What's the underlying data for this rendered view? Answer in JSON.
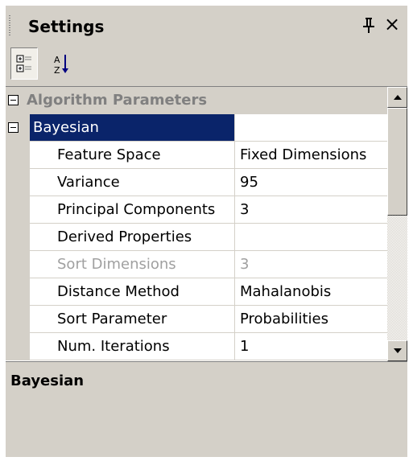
{
  "panel": {
    "title": "Settings",
    "pin_glyph": "↓",
    "close_glyph": "×"
  },
  "toolbar": {
    "categorized_icon": "categorized-view-icon",
    "alphabetical_icon": "alphabetical-sort-icon"
  },
  "grid": {
    "category": "Algorithm Parameters",
    "subcategory": "Bayesian",
    "rows": [
      {
        "name": "Feature Space",
        "value": "Fixed Dimensions"
      },
      {
        "name": "Variance",
        "value": "95"
      },
      {
        "name": "Principal Components",
        "value": "3"
      },
      {
        "name": "Derived Properties",
        "value": ""
      },
      {
        "name": "Sort Dimensions",
        "value": "3"
      },
      {
        "name": "Distance Method",
        "value": "Mahalanobis"
      },
      {
        "name": "Sort Parameter",
        "value": "Probabilities"
      },
      {
        "name": "Num. Iterations",
        "value": "1"
      }
    ]
  },
  "description": {
    "title": "Bayesian"
  },
  "colors": {
    "face": "#d4d0c8",
    "selection": "#0a246a",
    "disabled_text": "#a0a0a0"
  }
}
